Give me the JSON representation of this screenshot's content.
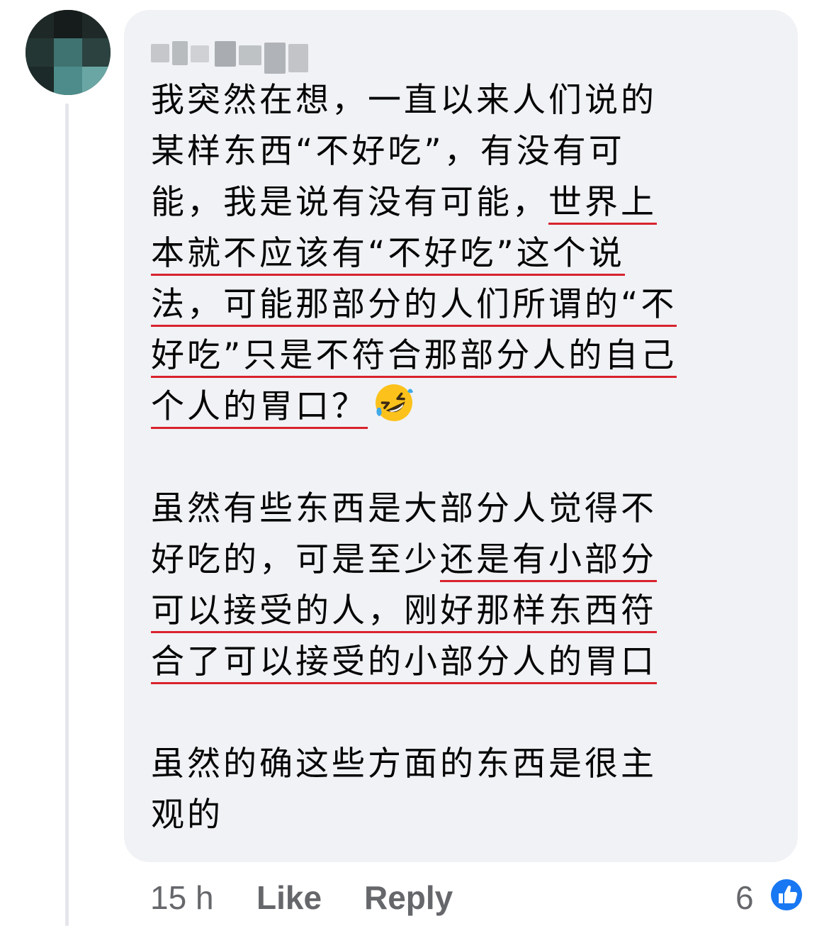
{
  "comment": {
    "paragraphs": [
      {
        "lines": [
          {
            "segments": [
              {
                "text": "我突然在想，一直以来人们说的",
                "u": false
              }
            ]
          },
          {
            "segments": [
              {
                "text": "某样东西“不好吃”，有没有可",
                "u": false
              }
            ]
          },
          {
            "segments": [
              {
                "text": "能，我是说有没有可能，",
                "u": false
              },
              {
                "text": "世界上",
                "u": true
              }
            ]
          },
          {
            "segments": [
              {
                "text": "本就不应该有“不好吃”这个说",
                "u": true
              }
            ]
          },
          {
            "segments": [
              {
                "text": "法，可能那部分的人们所谓的“不",
                "u": true
              }
            ]
          },
          {
            "segments": [
              {
                "text": "好吃”只是不符合那部分人的自己",
                "u": true
              }
            ]
          },
          {
            "segments": [
              {
                "text": "个人的胃口？",
                "u": true
              }
            ],
            "emoji": "rolling-on-floor-laughing-emoji"
          }
        ]
      },
      {
        "lines": [
          {
            "segments": [
              {
                "text": "虽然有些东西是大部分人觉得不",
                "u": false
              }
            ]
          },
          {
            "segments": [
              {
                "text": "好吃的，可是至少",
                "u": false
              },
              {
                "text": "还是有小部分",
                "u": true
              }
            ]
          },
          {
            "segments": [
              {
                "text": "可以接受的人，刚好那样东西符",
                "u": true
              }
            ]
          },
          {
            "segments": [
              {
                "text": "合了可以接受的小部分人的胃口",
                "u": true
              }
            ]
          }
        ]
      },
      {
        "lines": [
          {
            "segments": [
              {
                "text": "虽然的确这些方面的东西是很主",
                "u": false
              }
            ]
          },
          {
            "segments": [
              {
                "text": "观的",
                "u": false
              }
            ]
          }
        ]
      }
    ],
    "underline_color": "#d9232d"
  },
  "actions": {
    "time": "15 h",
    "like": "Like",
    "reply": "Reply"
  },
  "reactions": {
    "count": "6",
    "icon": "thumbs-up-icon",
    "icon_color": "#1877f2"
  },
  "colors": {
    "bubble": "#f0f2f5",
    "text": "#050505",
    "secondary": "#65676b",
    "thread_line": "#e4e6eb"
  }
}
